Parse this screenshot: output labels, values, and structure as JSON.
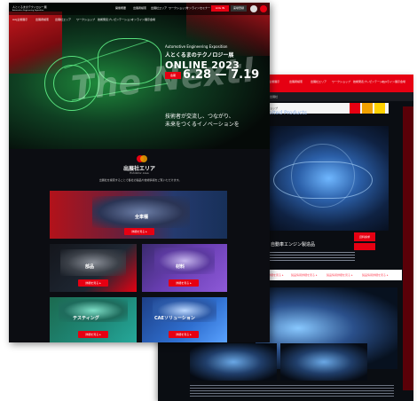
{
  "front": {
    "logo_line1": "人とくるまのテクノロジー展",
    "logo_line2": "Automotive Engineering Exposition",
    "menu": [
      "開催概要",
      "出展者検索",
      "出展社エリア",
      "ワークショップ",
      "オンラインセミナー"
    ],
    "nav": [
      "AAJ主催展示",
      "出展者検索",
      "出展社エリア",
      "ワークショップ",
      "技術発表プレゼンテーション",
      "オンライン展示会場"
    ],
    "login_label": "LOG IN",
    "register_label": "来場登録",
    "hero": {
      "eyebrow": "Automotive Engineering Exposition",
      "title": "人とくるまのテクノロジー展",
      "edition": "ONLINE 2023",
      "date_tag": "会期",
      "date_text": "6.28 — 7.19",
      "ghost_text": "The Next!",
      "tagline_line1": "技術者が交流し、つながり、",
      "tagline_line2": "未来をつくるイノベーションを"
    },
    "section": {
      "title": "出展社エリア",
      "subtitle": "Exhibitor Area",
      "desc": "出展社を検索することで各社の製品や技術情報をご覧いただけます。"
    },
    "cards": [
      {
        "label": "全車種",
        "button": "詳細を見る ▸"
      },
      {
        "label": "部品",
        "button": "詳細を見る ▸"
      },
      {
        "label": "材料",
        "button": "詳細を見る ▸"
      },
      {
        "label": "テスティング",
        "button": "詳細を見る ▸"
      },
      {
        "label": "CAEソリューション",
        "button": "詳細を見る ▸"
      }
    ]
  },
  "back": {
    "nav": [
      "AAJ主催展示",
      "出展者検索",
      "出展社エリア",
      "ワークショップ",
      "技術発表プレゼンテーション",
      "オンライン展示会場"
    ],
    "sub_nav": [
      "ホーム",
      "出展社"
    ],
    "tab_label": "ワークショップ",
    "heading": "Exhibited Products",
    "heading_sub": "出展製品",
    "product_title": "日東｜自動車エンジン製造品",
    "tag_label": "資料請求",
    "links": [
      "製品情報詳細を見る ▸",
      "製品情報詳細を見る ▸",
      "製品情報詳細を見る ▸",
      "製品情報詳細を見る ▸"
    ]
  },
  "colors": {
    "brand_red": "#e60012",
    "accent_green": "#58e07d",
    "accent_blue": "#8fb2e6",
    "orange": "#f0a000",
    "yellow": "#ffd000"
  }
}
